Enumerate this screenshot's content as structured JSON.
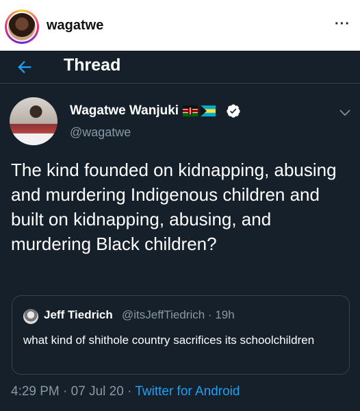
{
  "instagram": {
    "username": "wagatwe",
    "more_label": "···"
  },
  "thread": {
    "title": "Thread"
  },
  "tweet": {
    "author_name": "Wagatwe Wanjuki",
    "handle": "@wagatwe",
    "flags": [
      "kenya-flag",
      "bahamas-flag"
    ],
    "verified": true,
    "text": "The kind founded on kidnapping, abusing and murdering Indigenous children and built on kidnapping, abusing, and murdering Black children?",
    "time": "4:29 PM",
    "date": "07 Jul 20",
    "separator": "·",
    "source": "Twitter for Android"
  },
  "quoted_tweet": {
    "author_name": "Jeff Tiedrich",
    "handle": "@itsJeffTiedrich",
    "separator": "·",
    "age": "19h",
    "text": "what kind of shithole country sacrifices its schoolchildren"
  },
  "colors": {
    "background": "#15202b",
    "accent": "#1da1f2",
    "muted": "#8899a6",
    "border": "#38444d"
  }
}
